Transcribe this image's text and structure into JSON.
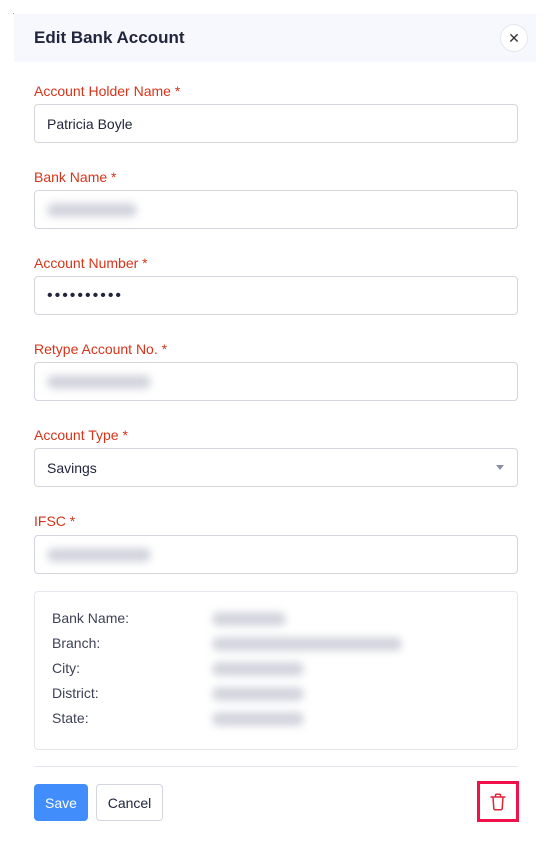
{
  "dialog": {
    "title": "Edit Bank Account",
    "close_icon": "close-icon"
  },
  "fields": {
    "account_holder": {
      "label": "Account Holder Name *",
      "value": "Patricia Boyle"
    },
    "bank_name": {
      "label": "Bank Name *",
      "value": ""
    },
    "account_number": {
      "label": "Account Number *",
      "value": "••••••••••"
    },
    "retype_account": {
      "label": "Retype Account No. *",
      "value": ""
    },
    "account_type": {
      "label": "Account Type *",
      "value": "Savings"
    },
    "ifsc": {
      "label": "IFSC *",
      "value": ""
    }
  },
  "info": {
    "bank_name_label": "Bank Name:",
    "branch_label": "Branch:",
    "city_label": "City:",
    "district_label": "District:",
    "state_label": "State:"
  },
  "footer": {
    "save_label": "Save",
    "cancel_label": "Cancel",
    "delete_icon": "trash-icon"
  },
  "colors": {
    "accent": "#408dfb",
    "label_required": "#d6341a",
    "delete_highlight": "#f0114b",
    "header_bg": "#f7f7fe"
  }
}
